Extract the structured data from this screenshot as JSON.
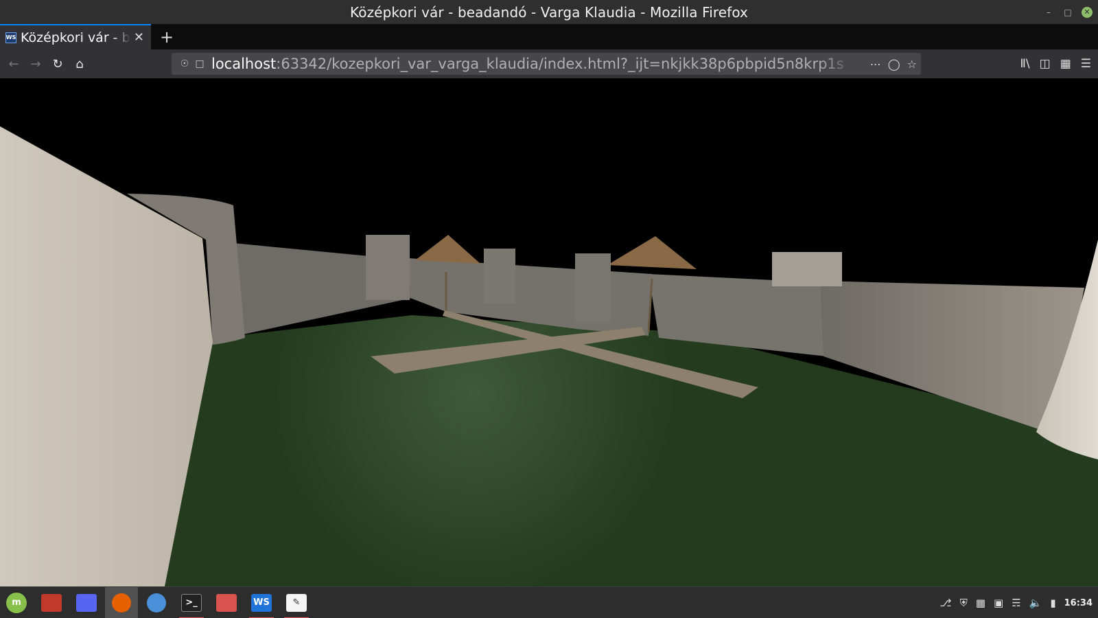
{
  "window": {
    "title": "Középkori vár - beadandó - Varga Klaudia - Mozilla Firefox"
  },
  "tab": {
    "title": "Középkori vár - beadandó - Varga Klaudia",
    "favicon_text": "WS",
    "new_tab_symbol": "+"
  },
  "navigation": {
    "url_host": "localhost",
    "url_rest": ":63342/kozepkori_var_varga_klaudia/index.html?_ijt=nkjkk38p6pbpid5n8krp1s"
  },
  "scene": {
    "sky_color": "#000000",
    "grass_color": "#253c1f",
    "wall_color": "#716d68",
    "roof_color": "#8a6a46",
    "path_color": "#8d806d"
  },
  "taskbar": {
    "clock": "16:34",
    "apps": [
      {
        "name": "linux-mint-menu",
        "label": "m"
      },
      {
        "name": "show-desktop",
        "label": ""
      },
      {
        "name": "discord",
        "label": ""
      },
      {
        "name": "firefox",
        "label": ""
      },
      {
        "name": "chromium",
        "label": ""
      },
      {
        "name": "terminal",
        "label": ">_"
      },
      {
        "name": "files",
        "label": ""
      },
      {
        "name": "webstorm",
        "label": "WS"
      },
      {
        "name": "text-editor",
        "label": ""
      }
    ]
  }
}
